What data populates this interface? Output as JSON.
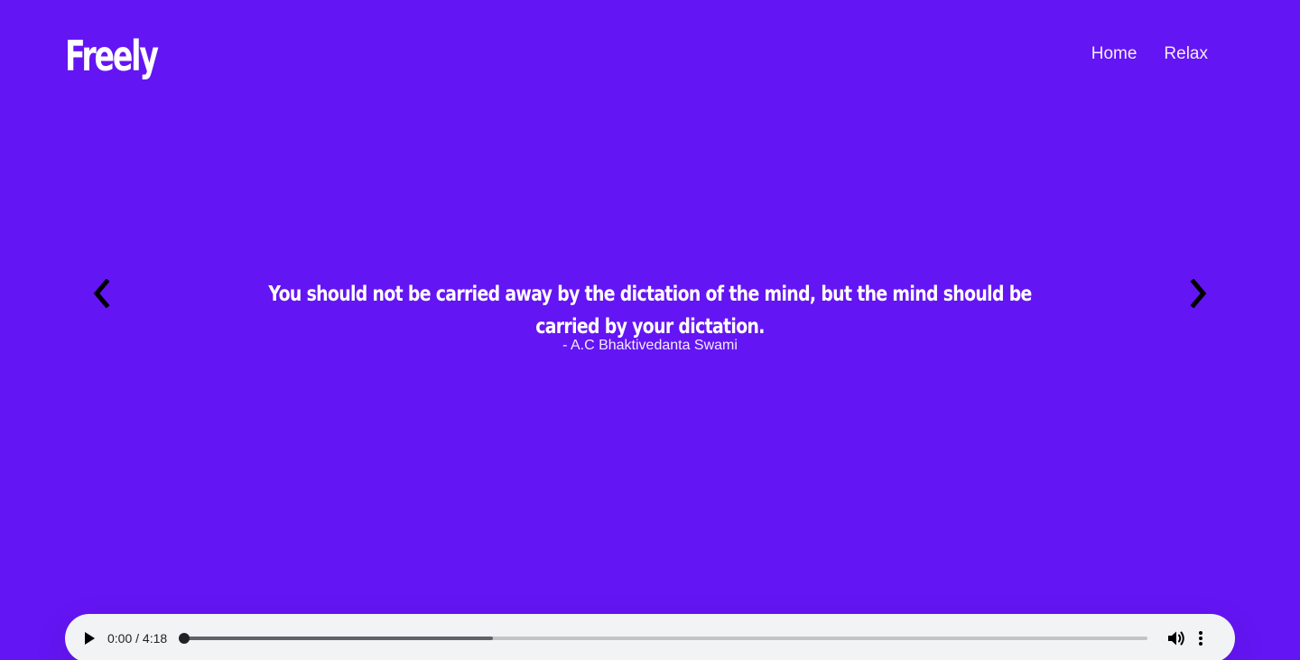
{
  "header": {
    "logo_text": "Freely",
    "nav_items": [
      {
        "label": "Home"
      },
      {
        "label": "Relax"
      }
    ]
  },
  "carousel": {
    "quote_text": "You should not be carried away by the dictation of the mind, but the mind should be carried by your dictation.",
    "author": "- A.C Bhaktivedanta Swami",
    "prev_icon": "chevron-left-icon",
    "next_icon": "chevron-right-icon"
  },
  "audio_player": {
    "time_display": "0:00 / 4:18",
    "current_time": "0:00",
    "duration": "4:18",
    "playback_fraction": 0.0,
    "buffered_fraction": 0.32,
    "icons": {
      "play": "play-icon",
      "volume": "volume-icon",
      "menu": "more-vertical-icon"
    }
  },
  "colors": {
    "background": "#6415f3",
    "text": "#ffffff",
    "player_background": "#f1f3f4"
  }
}
